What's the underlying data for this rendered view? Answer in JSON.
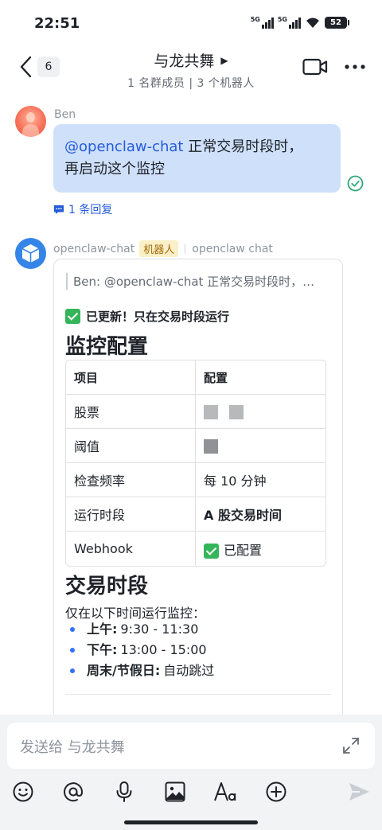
{
  "status_bar": {
    "time": "22:51",
    "signal1_label": "5G",
    "signal2_label": "5G",
    "battery": "52"
  },
  "header": {
    "back_count": "6",
    "title": "与龙共舞",
    "subtitle": "1 名群成员 | 3 个机器人"
  },
  "message1": {
    "sender": "Ben",
    "mention": "@openclaw-chat",
    "text_line1": " 正常交易时段时，",
    "text_line2": "再启动这个监控",
    "replies": "1 条回复"
  },
  "message2": {
    "sender": "openclaw-chat",
    "bot_tag": "机器人",
    "source": "openclaw chat",
    "quote": "Ben: @openclaw-chat 正常交易时段时，…",
    "updated": "已更新！只在交易时段运行",
    "h1": "监控配置",
    "table": {
      "headers": [
        "项目",
        "配置"
      ],
      "rows": [
        [
          "股票",
          ""
        ],
        [
          "阈值",
          ""
        ],
        [
          "检查频率",
          "每 10 分钟"
        ],
        [
          "运行时段",
          "A 股交易时间"
        ],
        [
          "Webhook",
          "已配置"
        ]
      ]
    },
    "h2": "交易时段",
    "para": "仅在以下时间运行监控：",
    "bullets": [
      {
        "label": "上午:",
        "value": "9:30 - 11:30"
      },
      {
        "label": "下午:",
        "value": "13:00 - 15:00"
      },
      {
        "label": "周末/节假日:",
        "value": "自动跳过"
      }
    ]
  },
  "input": {
    "placeholder": "发送给 与龙共舞"
  },
  "colors": {
    "accent": "#245bdb",
    "bubble": "#cfe0fb",
    "bot_tag_bg": "#fbefc8",
    "success": "#34b55a"
  },
  "icons": [
    "back-icon",
    "play-triangle-icon",
    "video-call-icon",
    "more-icon",
    "read-check-icon",
    "reply-icon",
    "bot-cube-icon",
    "expand-icon",
    "emoji-icon",
    "at-icon",
    "mic-icon",
    "image-icon",
    "text-format-icon",
    "plus-icon",
    "send-icon"
  ]
}
